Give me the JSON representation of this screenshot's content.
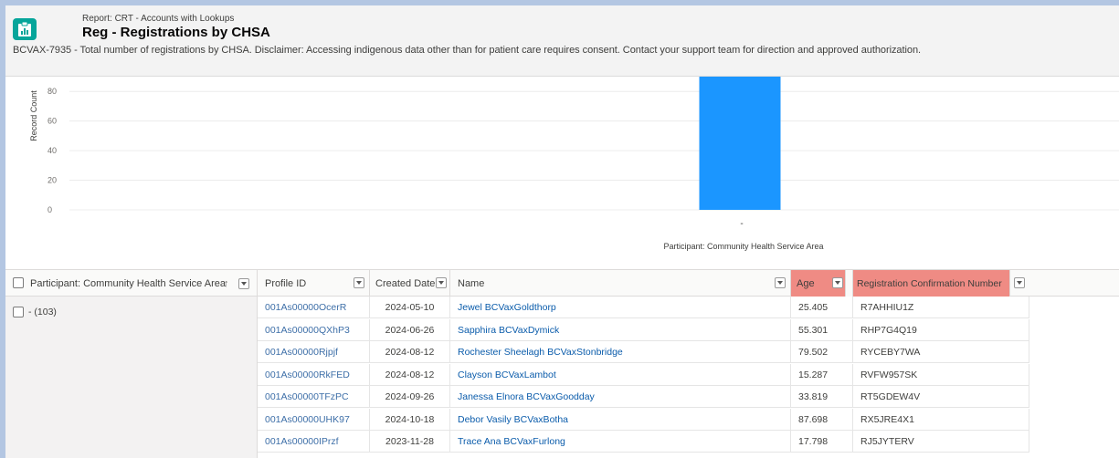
{
  "header": {
    "report_type": "Report: CRT - Accounts with Lookups",
    "title": "Reg - Registrations by CHSA",
    "description": "BCVAX-7935 - Total number of registrations by CHSA. Disclaimer: Accessing indigenous data other than for patient care requires consent. Contact your support team for direction and approved authorization.",
    "icon": "report-icon"
  },
  "chart_data": {
    "type": "bar",
    "categories": [
      "-"
    ],
    "values": [
      103
    ],
    "xlabel": "Participant: Community Health Service Area",
    "ylabel": "Record Count",
    "yticks": [
      0,
      20,
      40,
      60,
      80
    ],
    "ylim": [
      0,
      90
    ],
    "grid": true,
    "bar_color": "#1b96ff"
  },
  "table": {
    "group_column": {
      "label": "Participant: Community Health Service Area",
      "sort_indicator": "↑",
      "group_label": "- (103)"
    },
    "columns": [
      {
        "key": "profile_id",
        "label": "Profile ID",
        "highlight": false
      },
      {
        "key": "created_date",
        "label": "Created Date",
        "highlight": false
      },
      {
        "key": "name",
        "label": "Name",
        "highlight": false
      },
      {
        "key": "age",
        "label": "Age",
        "highlight": true
      },
      {
        "key": "reg_number",
        "label": "Registration Confirmation Number",
        "highlight": true
      }
    ],
    "highlight_color": "#ef8b84",
    "rows": [
      {
        "profile_id": "001As00000OcerR",
        "created_date": "2024-05-10",
        "name": "Jewel BCVaxGoldthorp",
        "age": "25.405",
        "reg_number": "R7AHHIU1Z"
      },
      {
        "profile_id": "001As00000QXhP3",
        "created_date": "2024-06-26",
        "name": "Sapphira BCVaxDymick",
        "age": "55.301",
        "reg_number": "RHP7G4Q19"
      },
      {
        "profile_id": "001As00000Rjpjf",
        "created_date": "2024-08-12",
        "name": "Rochester Sheelagh BCVaxStonbridge",
        "age": "79.502",
        "reg_number": "RYCEBY7WA"
      },
      {
        "profile_id": "001As00000RkFED",
        "created_date": "2024-08-12",
        "name": "Clayson BCVaxLambot",
        "age": "15.287",
        "reg_number": "RVFW957SK"
      },
      {
        "profile_id": "001As00000TFzPC",
        "created_date": "2024-09-26",
        "name": "Janessa Elnora BCVaxGoodday",
        "age": "33.819",
        "reg_number": "RT5GDEW4V"
      },
      {
        "profile_id": "001As00000UHK97",
        "created_date": "2024-10-18",
        "name": "Debor Vasily BCVaxBotha",
        "age": "87.698",
        "reg_number": "RX5JRE4X1"
      },
      {
        "profile_id": "001As00000IPrzf",
        "created_date": "2023-11-28",
        "name": "Trace Ana BCVaxFurlong",
        "age": "17.798",
        "reg_number": "RJ5JYTERV"
      }
    ]
  }
}
